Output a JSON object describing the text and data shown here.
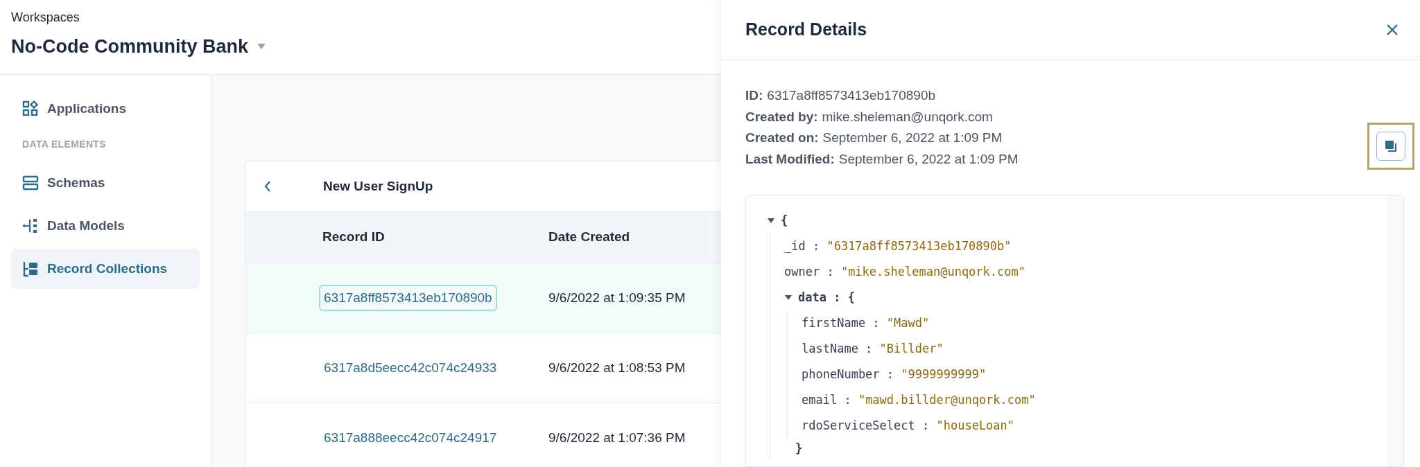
{
  "header": {
    "label": "Workspaces",
    "workspace": "No-Code Community Bank"
  },
  "sidebar": {
    "items": [
      {
        "kind": "item",
        "label": "Applications",
        "selected": false
      },
      {
        "kind": "section",
        "label": "DATA ELEMENTS"
      },
      {
        "kind": "item",
        "label": "Schemas",
        "selected": false
      },
      {
        "kind": "item",
        "label": "Data Models",
        "selected": false
      },
      {
        "kind": "item",
        "label": "Record Collections",
        "selected": true
      }
    ]
  },
  "table": {
    "title": "New User SignUp",
    "columns": [
      "Record ID",
      "Date Created"
    ],
    "rows": [
      {
        "record_id": "6317a8ff8573413eb170890b",
        "date_created": "9/6/2022 at 1:09:35 PM",
        "selected": true
      },
      {
        "record_id": "6317a8d5eecc42c074c24933",
        "date_created": "9/6/2022 at 1:08:53 PM",
        "selected": false
      },
      {
        "record_id": "6317a888eecc42c074c24917",
        "date_created": "9/6/2022 at 1:07:36 PM",
        "selected": false
      }
    ]
  },
  "details": {
    "title": "Record Details",
    "fields": [
      {
        "label": "ID:",
        "value": "6317a8ff8573413eb170890b"
      },
      {
        "label": "Created by:",
        "value": "mike.sheleman@unqork.com"
      },
      {
        "label": "Created on:",
        "value": "September 6, 2022 at 1:09 PM"
      },
      {
        "label": "Last Modified:",
        "value": "September 6, 2022 at 1:09 PM"
      }
    ],
    "copy_button": {
      "highlighted": true
    },
    "json_tree": {
      "open": "{",
      "expanded": true,
      "children": [
        {
          "key": "_id",
          "sep": ":",
          "value": "\"6317a8ff8573413eb170890b\""
        },
        {
          "key": "owner",
          "sep": ":",
          "value": "\"mike.sheleman@unqork.com\""
        },
        {
          "key": "data",
          "sep": ":",
          "open": "{",
          "expanded": true,
          "close": "}",
          "children": [
            {
              "key": "firstName",
              "sep": ":",
              "value": "\"Mawd\""
            },
            {
              "key": "lastName",
              "sep": ":",
              "value": "\"Billder\""
            },
            {
              "key": "phoneNumber",
              "sep": ":",
              "value": "\"9999999999\""
            },
            {
              "key": "email",
              "sep": ":",
              "value": "\"mawd.billder@unqork.com\""
            },
            {
              "key": "rdoServiceSelect",
              "sep": ":",
              "value": "\"houseLoan\""
            }
          ]
        }
      ]
    }
  }
}
